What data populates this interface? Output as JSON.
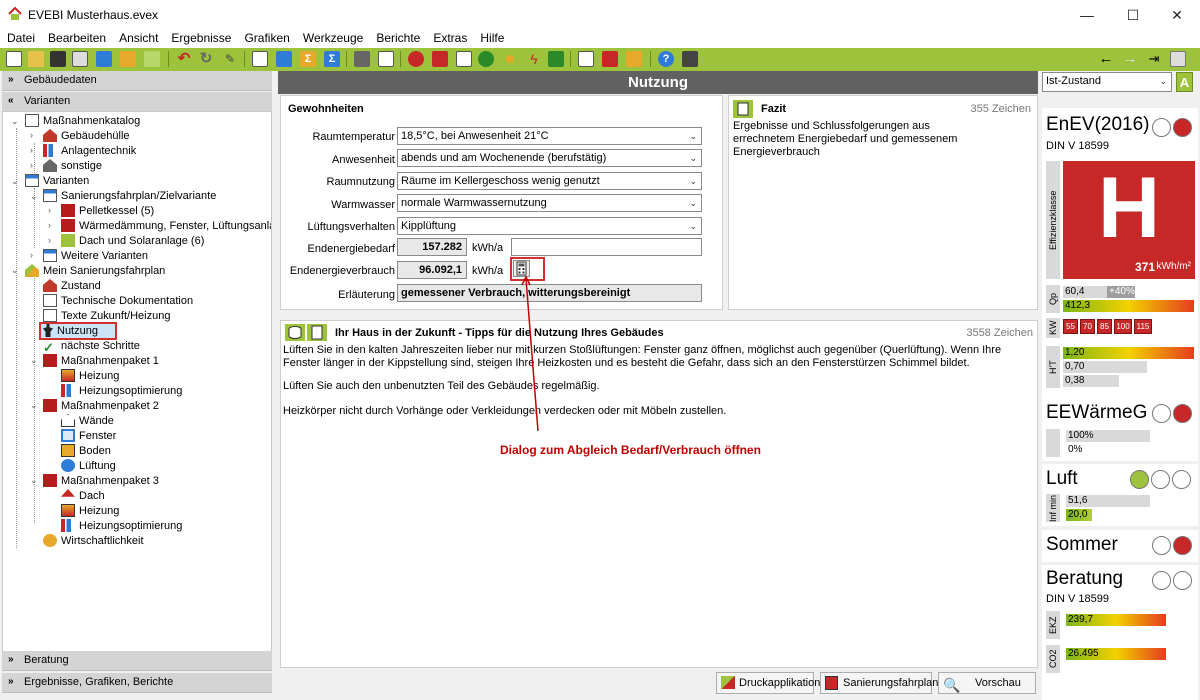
{
  "window": {
    "title": "EVEBI Musterhaus.evex",
    "minimize": "—",
    "maximize": "☐",
    "close": "✕"
  },
  "menu": [
    "Datei",
    "Bearbeiten",
    "Ansicht",
    "Ergebnisse",
    "Grafiken",
    "Werkzeuge",
    "Berichte",
    "Extras",
    "Hilfe"
  ],
  "accordion": {
    "gebaeude": "Gebäudedaten",
    "varianten": "Varianten",
    "beratung": "Beratung",
    "ergebnisse": "Ergebnisse, Grafiken, Berichte"
  },
  "tree": {
    "katalog": "Maßnahmenkatalog",
    "huelle": "Gebäudehülle",
    "anlage": "Anlagentechnik",
    "sonstige": "sonstige",
    "varianten": "Varianten",
    "sanfp": "Sanierungsfahrplan/Zielvariante",
    "pellet": "Pelletkessel (5)",
    "waerme": "Wärmedämmung, Fenster, Lüftungsanlage",
    "dach": "Dach und Solaranlage (6)",
    "weitere": "Weitere Varianten",
    "meinsfp": "Mein Sanierungsfahrplan",
    "zustand": "Zustand",
    "techdok": "Technische Dokumentation",
    "texte": "Texte Zukunft/Heizung",
    "nutzung": "Nutzung",
    "naechste": "nächste Schritte",
    "mp1": "Maßnahmenpaket 1",
    "heizung": "Heizung",
    "heizopt": "Heizungsoptimierung",
    "mp2": "Maßnahmenpaket 2",
    "waende": "Wände",
    "fenster": "Fenster",
    "boden": "Boden",
    "lueftung": "Lüftung",
    "mp3": "Maßnahmenpaket 3",
    "dach2": "Dach",
    "wirtschaft": "Wirtschaftlichkeit"
  },
  "main": {
    "title": "Nutzung",
    "gewohnheiten": "Gewohnheiten",
    "fields": {
      "raumtemp_label": "Raumtemperatur",
      "raumtemp": "18,5°C, bei Anwesenheit 21°C",
      "anwes_label": "Anwesenheit",
      "anwes": "abends und am Wochenende (berufstätig)",
      "raumnutz_label": "Raumnutzung",
      "raumnutz": "Räume im Kellergeschoss wenig genutzt",
      "ww_label": "Warmwasser",
      "ww": "normale Warmwassernutzung",
      "lueft_label": "Lüftungsverhalten",
      "lueft": "Kipplüftung",
      "bedarf_label": "Endenergiebedarf",
      "bedarf": "157.282",
      "bedarf_unit": "kWh/a",
      "verbrauch_label": "Endenergieverbrauch",
      "verbrauch": "96.092,1",
      "verbrauch_unit": "kWh/a",
      "erl_label": "Erläuterung",
      "erl": "gemessener Verbrauch, witterungsbereinigt"
    },
    "fazit": {
      "title": "Fazit",
      "count": "355 Zeichen",
      "text": "Ergebnisse und Schlussfolgerungen aus errechnetem Energiebedarf und gemessenem Energieverbrauch"
    },
    "tipps": {
      "title": "Ihr Haus in der Zukunft - Tipps für die Nutzung Ihres Gebäudes",
      "count": "3558 Zeichen",
      "p1": "Lüften Sie in den kalten Jahreszeiten lieber nur mit kurzen Stoßlüftungen: Fenster ganz öffnen, möglichst auch gegenüber (Querlüftung). Wenn Ihre Fenster länger in der Kippstellung sind, steigen Ihre Heizkosten und es besteht die Gefahr, dass sich an den Fensterstürzen Schimmel bildet.",
      "p2": "Lüften Sie auch den unbenutzten Teil des Gebäudes regelmäßig.",
      "p3": "Heizkörper nicht durch Vorhänge oder Verkleidungen verdecken oder mit Möbeln zustellen."
    },
    "annotation": "Dialog zum Abgleich Bedarf/Verbrauch öffnen"
  },
  "buttons": {
    "druck": "Druckapplikation",
    "sfp": "Sanierungsfahrplan",
    "vorschau": "Vorschau"
  },
  "right": {
    "state": "Ist-Zustand",
    "state_badge": "A",
    "enev": "EnEV(2016)",
    "din": "DIN V 18599",
    "effclass": "H",
    "effclass_label": "Effizienzklasse",
    "eff_value": "371",
    "eff_unit": "kWh/m²",
    "qp_label": "Qp",
    "qp1": "60,4",
    "qp_pct": "+40%",
    "qp2": "412,3",
    "kw_label": "KW",
    "kw": [
      "55",
      "70",
      "85",
      "100",
      "115"
    ],
    "ht_label": "H'T",
    "ht1": "1,20",
    "ht2": "0,70",
    "ht3": "0,38",
    "eew": "EEWärmeG",
    "eew1": "100%",
    "eew2": "0%",
    "luft": "Luft",
    "luft_label": "Inf min",
    "luft1": "51,6",
    "luft2": "20,0",
    "sommer": "Sommer",
    "beratung": "Beratung",
    "din2": "DIN V 18599",
    "ekz_label": "EKZ",
    "ekz": "239,7",
    "co2_label": "CO2",
    "co2": "26.495"
  },
  "colors": {
    "accent": "#9cc33b",
    "header": "#616161",
    "red": "#c62828",
    "annotation": "#c00000"
  }
}
